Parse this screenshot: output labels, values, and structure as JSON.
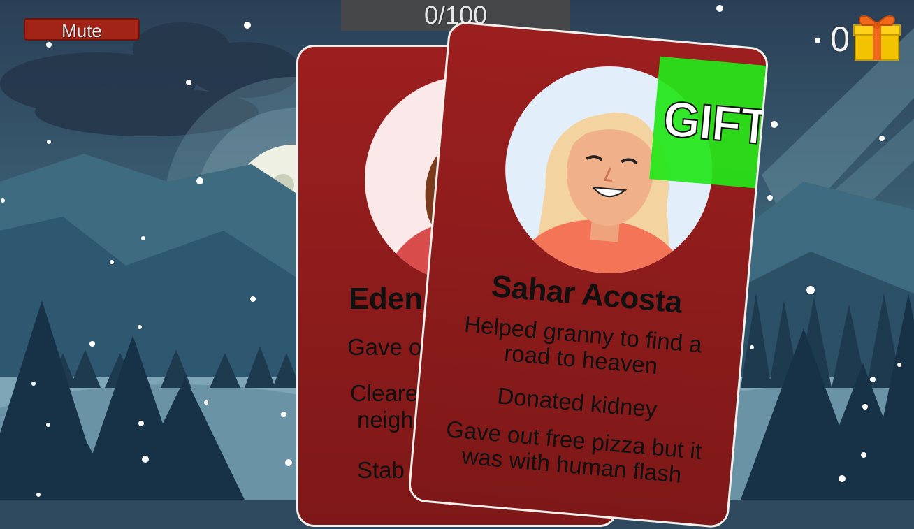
{
  "hud": {
    "mute_label": "Mute",
    "score_text": "0/100",
    "gift_count": "0",
    "gift_icon": "gift-box-icon"
  },
  "cards": {
    "back": {
      "name": "Eden",
      "deeds": [
        "Gave o",
        "Cleare",
        "neigh",
        "Stab"
      ]
    },
    "front": {
      "name": "Sahar Acosta",
      "deeds": [
        "Helped granny to find a road to heaven",
        "Donated kidney",
        "Gave out free pizza but it was with human flash"
      ],
      "stamp_label": "GIFT"
    }
  },
  "colors": {
    "card_red": "#9c1f1f",
    "mute_red": "#a12416",
    "gift_green": "#23e619",
    "score_bg": "#464646"
  }
}
